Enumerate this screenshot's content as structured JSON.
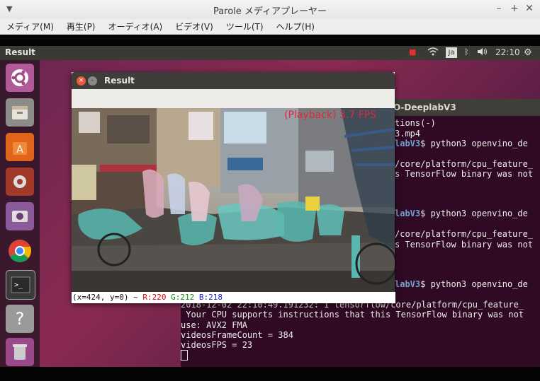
{
  "window": {
    "title": "Parole メディアプレーヤー",
    "menu_arrow": "▼",
    "min": "–",
    "max": "+",
    "close": "✕"
  },
  "menu": [
    "メディア(M)",
    "再生(P)",
    "オーディオ(A)",
    "ビデオ(V)",
    "ツール(T)",
    "ヘルプ(H)"
  ],
  "panel": {
    "title": "Result",
    "lang": "Ja",
    "time": "22:10"
  },
  "terminal": {
    "title": "O-DeeplabV3",
    "lines": [
      {
        "pre": "",
        "mid": "",
        "text": "tions(-)"
      },
      {
        "pre": "",
        "mid": "",
        "text": "3.mp4"
      },
      {
        "pre": "",
        "mid": "labV3",
        "text": "$ python3 openvino_de"
      },
      {
        "pre": "",
        "mid": "",
        "text": ""
      },
      {
        "pre": "",
        "mid": "",
        "text": "/core/platform/cpu_feature_"
      },
      {
        "pre": "",
        "mid": "",
        "text": "s TensorFlow binary was not"
      },
      {
        "pre": "",
        "mid": "",
        "text": ""
      },
      {
        "pre": "",
        "mid": "",
        "text": ""
      },
      {
        "pre": "",
        "mid": "labV3",
        "text": "$ python3 openvino_de"
      },
      {
        "pre": "",
        "mid": "",
        "text": ""
      },
      {
        "pre": "",
        "mid": "",
        "text": "/core/platform/cpu_feature_"
      },
      {
        "pre": "",
        "mid": "",
        "text": "s TensorFlow binary was not"
      }
    ],
    "lines_bottom": [
      {
        "mid": "labV3",
        "text": "$ python3 openvino_de"
      },
      {
        "mid": "",
        "text": "2018-12-02 22:10:49.191232: I tensorflow/core/platform/cpu_feature_"
      },
      {
        "mid": "",
        "text": " Your CPU supports instructions that this TensorFlow binary was not"
      },
      {
        "mid": "",
        "text": "use: AVX2 FMA"
      },
      {
        "mid": "",
        "text": "videosFrameCount = 384"
      },
      {
        "mid": "",
        "text": "videosFPS = 23"
      }
    ]
  },
  "result": {
    "title": "Result",
    "fps": "(Playback) 3.7 FPS",
    "status_xy": "(x=424, y=0) ~ ",
    "status_r": "R:220",
    "status_g": "G:212",
    "status_b": "B:218"
  },
  "colors": {
    "r": "#d0101a",
    "g": "#108a10",
    "b": "#1a1ad0"
  }
}
